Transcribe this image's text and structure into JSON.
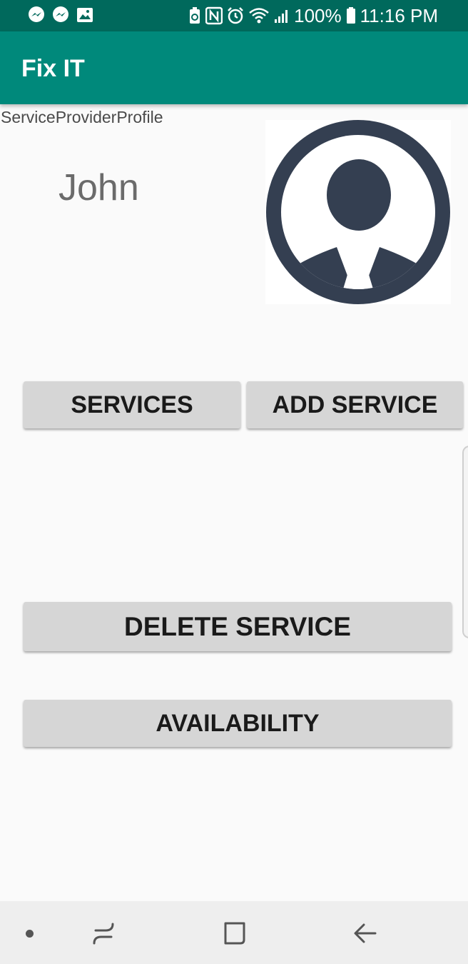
{
  "status_bar": {
    "battery": "100%",
    "time": "11:16 PM",
    "notification_icons": [
      "messenger-icon",
      "messenger-icon",
      "image-icon"
    ],
    "system_icons": [
      "battery-saver-icon",
      "nfc-icon",
      "alarm-icon",
      "wifi-icon",
      "signal-icon",
      "battery-icon"
    ]
  },
  "app_bar": {
    "title": "Fix IT",
    "color": "#00897b"
  },
  "profile": {
    "activity_label": "ServiceProviderProfile",
    "name": "John",
    "avatar_icon": "person-avatar-icon"
  },
  "buttons": {
    "services": "SERVICES",
    "add_service": "ADD SERVICE",
    "delete_service": "DELETE SERVICE",
    "availability": "AVAILABILITY"
  },
  "nav_bar": {
    "items": [
      "dot-icon",
      "recents-icon",
      "home-icon",
      "back-icon"
    ]
  },
  "colors": {
    "status_bar": "#00695c",
    "app_bar": "#00897b",
    "button": "#d6d6d6",
    "avatar": "#343f51"
  }
}
